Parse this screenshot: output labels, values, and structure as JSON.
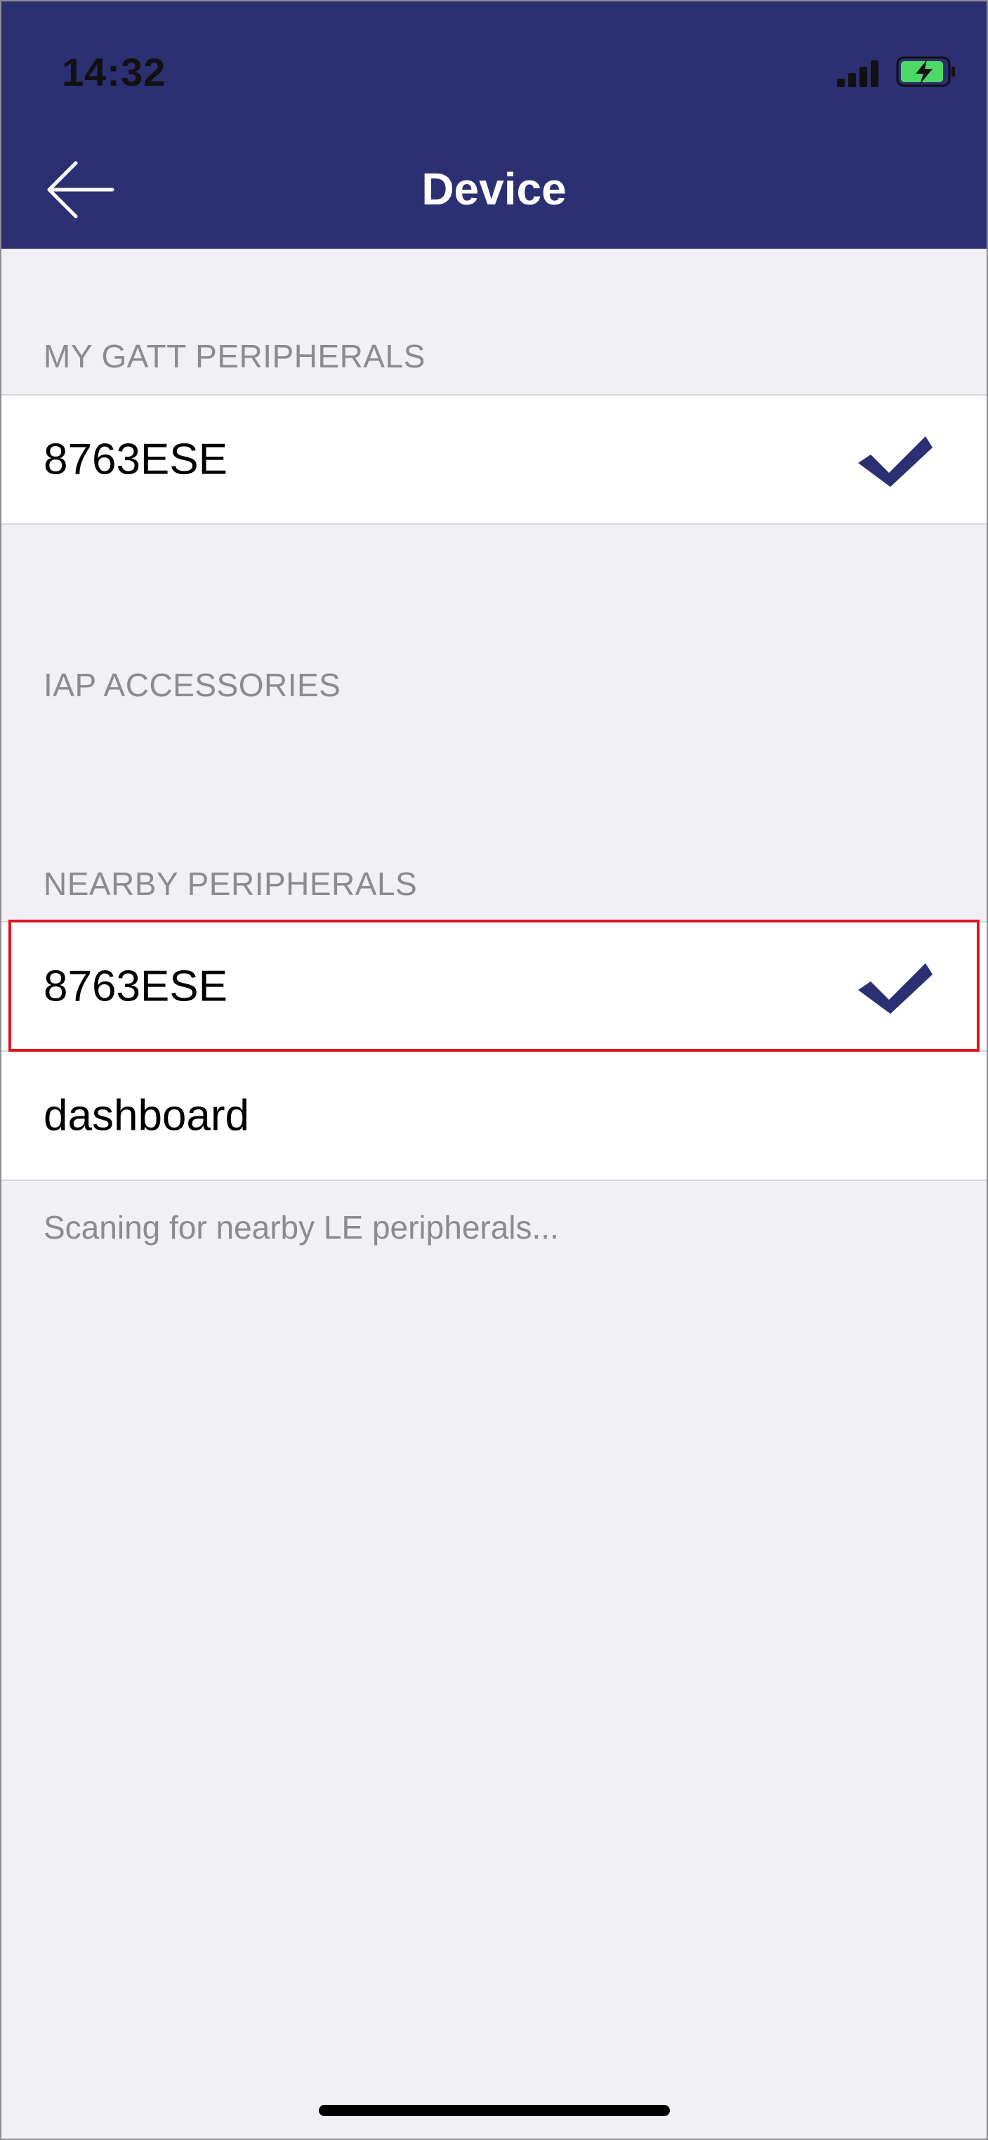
{
  "status_bar": {
    "time": "14:32"
  },
  "nav": {
    "title": "Device"
  },
  "sections": {
    "gatt": {
      "header": "MY GATT PERIPHERALS",
      "items": [
        {
          "label": "8763ESE"
        }
      ]
    },
    "iap": {
      "header": "IAP ACCESSORIES"
    },
    "nearby": {
      "header": "NEARBY PERIPHERALS",
      "items": [
        {
          "label": "8763ESE"
        },
        {
          "label": "dashboard"
        }
      ],
      "footer": "Scaning for nearby LE peripherals..."
    }
  },
  "icons": {
    "back": "arrow-left-icon",
    "check": "checkmark-icon",
    "signal": "cellular-signal-icon",
    "battery": "battery-charging-icon"
  },
  "colors": {
    "nav_bar": "#2c2f72",
    "checkmark": "#2c2f72",
    "highlight": "#e0141e",
    "battery_fill": "#4cd964",
    "background": "#f0f0f5"
  }
}
